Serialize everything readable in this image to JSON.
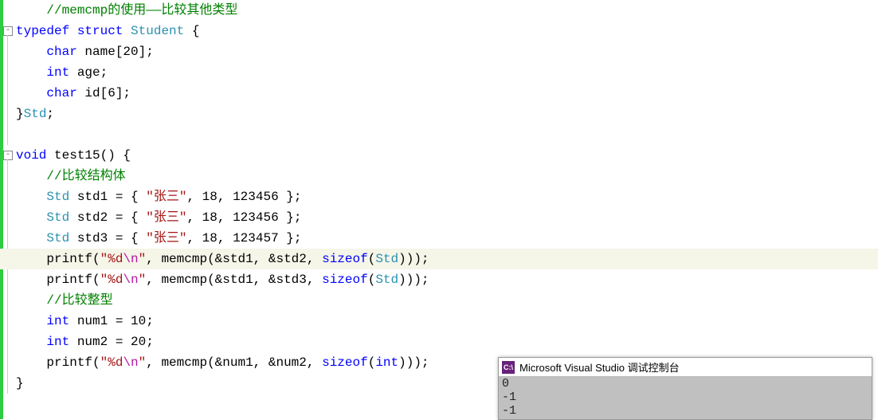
{
  "code": {
    "lines": [
      {
        "indent": "    ",
        "tokens": [
          {
            "t": "//memcmp的使用——比较其他类型",
            "c": "c-comment"
          }
        ]
      },
      {
        "fold": true,
        "tokens": [
          {
            "t": "typedef",
            "c": "c-keyword"
          },
          {
            "t": " ",
            "c": ""
          },
          {
            "t": "struct",
            "c": "c-keyword"
          },
          {
            "t": " ",
            "c": ""
          },
          {
            "t": "Student",
            "c": "c-type"
          },
          {
            "t": " {",
            "c": "c-punc"
          }
        ]
      },
      {
        "indent": "    ",
        "tokens": [
          {
            "t": "char",
            "c": "c-keyword"
          },
          {
            "t": " name[",
            "c": "c-punc"
          },
          {
            "t": "20",
            "c": "c-num"
          },
          {
            "t": "];",
            "c": "c-punc"
          }
        ]
      },
      {
        "indent": "    ",
        "tokens": [
          {
            "t": "int",
            "c": "c-keyword"
          },
          {
            "t": " age;",
            "c": "c-punc"
          }
        ]
      },
      {
        "indent": "    ",
        "tokens": [
          {
            "t": "char",
            "c": "c-keyword"
          },
          {
            "t": " id[",
            "c": "c-punc"
          },
          {
            "t": "6",
            "c": "c-num"
          },
          {
            "t": "];",
            "c": "c-punc"
          }
        ]
      },
      {
        "tokens": [
          {
            "t": "}",
            "c": "c-punc"
          },
          {
            "t": "Std",
            "c": "c-type"
          },
          {
            "t": ";",
            "c": "c-punc"
          }
        ]
      },
      {
        "tokens": [
          {
            "t": "",
            "c": ""
          }
        ]
      },
      {
        "fold": true,
        "tokens": [
          {
            "t": "void",
            "c": "c-keyword"
          },
          {
            "t": " test15",
            "c": "c-func"
          },
          {
            "t": "() {",
            "c": "c-punc"
          }
        ]
      },
      {
        "indent": "    ",
        "tokens": [
          {
            "t": "//比较结构体",
            "c": "c-comment"
          }
        ]
      },
      {
        "indent": "    ",
        "tokens": [
          {
            "t": "Std",
            "c": "c-type"
          },
          {
            "t": " std1 = { ",
            "c": "c-punc"
          },
          {
            "t": "\"张三\"",
            "c": "c-string"
          },
          {
            "t": ", ",
            "c": "c-punc"
          },
          {
            "t": "18",
            "c": "c-num"
          },
          {
            "t": ", ",
            "c": "c-punc"
          },
          {
            "t": "123456",
            "c": "c-num"
          },
          {
            "t": " };",
            "c": "c-punc"
          }
        ]
      },
      {
        "indent": "    ",
        "tokens": [
          {
            "t": "Std",
            "c": "c-type"
          },
          {
            "t": " std2 = { ",
            "c": "c-punc"
          },
          {
            "t": "\"张三\"",
            "c": "c-string"
          },
          {
            "t": ", ",
            "c": "c-punc"
          },
          {
            "t": "18",
            "c": "c-num"
          },
          {
            "t": ", ",
            "c": "c-punc"
          },
          {
            "t": "123456",
            "c": "c-num"
          },
          {
            "t": " };",
            "c": "c-punc"
          }
        ]
      },
      {
        "indent": "    ",
        "tokens": [
          {
            "t": "Std",
            "c": "c-type"
          },
          {
            "t": " std3 = { ",
            "c": "c-punc"
          },
          {
            "t": "\"张三\"",
            "c": "c-string"
          },
          {
            "t": ", ",
            "c": "c-punc"
          },
          {
            "t": "18",
            "c": "c-num"
          },
          {
            "t": ", ",
            "c": "c-punc"
          },
          {
            "t": "123457",
            "c": "c-num"
          },
          {
            "t": " };",
            "c": "c-punc"
          }
        ]
      },
      {
        "hl": true,
        "indent": "    ",
        "tokens": [
          {
            "t": "printf",
            "c": "c-func"
          },
          {
            "t": "(",
            "c": "c-punc"
          },
          {
            "t": "\"%d",
            "c": "c-string"
          },
          {
            "t": "\\n",
            "c": "c-escape"
          },
          {
            "t": "\"",
            "c": "c-string"
          },
          {
            "t": ", memcmp(&std1, &std2, ",
            "c": "c-punc"
          },
          {
            "t": "sizeof",
            "c": "c-keyword"
          },
          {
            "t": "(",
            "c": "c-punc"
          },
          {
            "t": "Std",
            "c": "c-type"
          },
          {
            "t": ")));",
            "c": "c-punc"
          }
        ]
      },
      {
        "indent": "    ",
        "tokens": [
          {
            "t": "printf",
            "c": "c-func"
          },
          {
            "t": "(",
            "c": "c-punc"
          },
          {
            "t": "\"%d",
            "c": "c-string"
          },
          {
            "t": "\\n",
            "c": "c-escape"
          },
          {
            "t": "\"",
            "c": "c-string"
          },
          {
            "t": ", memcmp(&std1, &std3, ",
            "c": "c-punc"
          },
          {
            "t": "sizeof",
            "c": "c-keyword"
          },
          {
            "t": "(",
            "c": "c-punc"
          },
          {
            "t": "Std",
            "c": "c-type"
          },
          {
            "t": ")));",
            "c": "c-punc"
          }
        ]
      },
      {
        "indent": "    ",
        "tokens": [
          {
            "t": "//比较整型",
            "c": "c-comment"
          }
        ]
      },
      {
        "indent": "    ",
        "tokens": [
          {
            "t": "int",
            "c": "c-keyword"
          },
          {
            "t": " num1 = ",
            "c": "c-punc"
          },
          {
            "t": "10",
            "c": "c-num"
          },
          {
            "t": ";",
            "c": "c-punc"
          }
        ]
      },
      {
        "indent": "    ",
        "tokens": [
          {
            "t": "int",
            "c": "c-keyword"
          },
          {
            "t": " num2 = ",
            "c": "c-punc"
          },
          {
            "t": "20",
            "c": "c-num"
          },
          {
            "t": ";",
            "c": "c-punc"
          }
        ]
      },
      {
        "indent": "    ",
        "tokens": [
          {
            "t": "printf",
            "c": "c-func"
          },
          {
            "t": "(",
            "c": "c-punc"
          },
          {
            "t": "\"%d",
            "c": "c-string"
          },
          {
            "t": "\\n",
            "c": "c-escape"
          },
          {
            "t": "\"",
            "c": "c-string"
          },
          {
            "t": ", memcmp(&num1, &num2, ",
            "c": "c-punc"
          },
          {
            "t": "sizeof",
            "c": "c-keyword"
          },
          {
            "t": "(",
            "c": "c-punc"
          },
          {
            "t": "int",
            "c": "c-keyword"
          },
          {
            "t": ")));",
            "c": "c-punc"
          }
        ]
      },
      {
        "tokens": [
          {
            "t": "}",
            "c": "c-punc"
          }
        ]
      }
    ]
  },
  "console": {
    "icon_text": "C:\\",
    "title": "Microsoft Visual Studio 调试控制台",
    "output": [
      "0",
      "-1",
      "-1"
    ]
  }
}
